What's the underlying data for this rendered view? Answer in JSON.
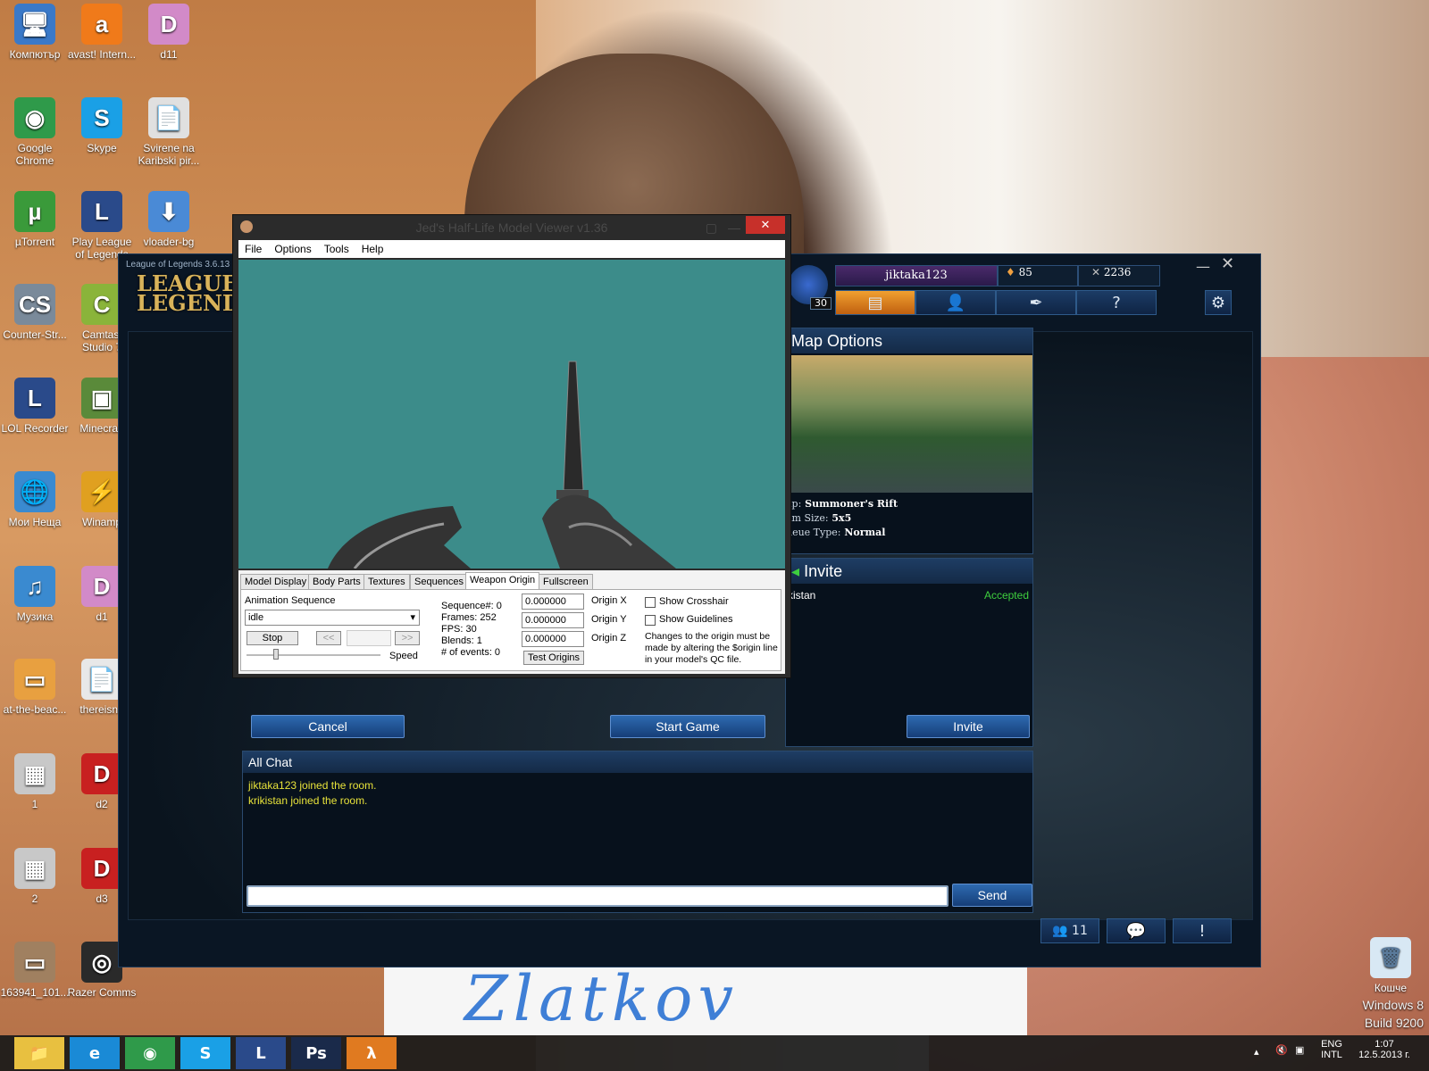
{
  "desktop": {
    "icons": [
      {
        "label": "Компютър",
        "symbol": "🖥",
        "bg": "#3a79c8"
      },
      {
        "label": "avast! Intern...",
        "symbol": "a",
        "bg": "#f07a1a"
      },
      {
        "label": "d11",
        "symbol": "D",
        "bg": "#d28ac8"
      },
      {
        "label": "Google Chrome",
        "symbol": "◉",
        "bg": "#2f9a4a"
      },
      {
        "label": "Skype",
        "symbol": "S",
        "bg": "#1aa0e6"
      },
      {
        "label": "Svirene na Karibski pir...",
        "symbol": "📄",
        "bg": "#e0e0e0"
      },
      {
        "label": "µTorrent",
        "symbol": "µ",
        "bg": "#3a9a3a"
      },
      {
        "label": "Play League of Legends",
        "symbol": "L",
        "bg": "#2a4a8a"
      },
      {
        "label": "vloader-bg",
        "symbol": "⬇",
        "bg": "#4a8ad6"
      },
      {
        "label": "Counter-Str...",
        "symbol": "CS",
        "bg": "#7a8a9a"
      },
      {
        "label": "Camtasi Studio 7",
        "symbol": "C",
        "bg": "#8ab43a"
      },
      {
        "label": "LOL Recorder",
        "symbol": "L",
        "bg": "#2a4a8a"
      },
      {
        "label": "Minecraft",
        "symbol": "▣",
        "bg": "#5a8a3a"
      },
      {
        "label": "Мои Неща",
        "symbol": "🌐",
        "bg": "#3a8ad0"
      },
      {
        "label": "Winamp",
        "symbol": "⚡",
        "bg": "#e0a020"
      },
      {
        "label": "Музика",
        "symbol": "♫",
        "bg": "#3a8ad0"
      },
      {
        "label": "d1",
        "symbol": "D",
        "bg": "#d28ac8"
      },
      {
        "label": "at-the-beac...",
        "symbol": "▭",
        "bg": "#e8a040"
      },
      {
        "label": "thereisno",
        "symbol": "📄",
        "bg": "#e8e8e8"
      },
      {
        "label": "1",
        "symbol": "▦",
        "bg": "#c8c8c8"
      },
      {
        "label": "d2",
        "symbol": "D",
        "bg": "#c82020"
      },
      {
        "label": "2",
        "symbol": "▦",
        "bg": "#c8c8c8"
      },
      {
        "label": "d3",
        "symbol": "D",
        "bg": "#c82020"
      },
      {
        "label": "163941_101...",
        "symbol": "▭",
        "bg": "#a08060"
      },
      {
        "label": "Razer Comms",
        "symbol": "◎",
        "bg": "#2a2a2a"
      }
    ],
    "recycle_bin": "Кошче",
    "watermark_line1": "Windows 8",
    "watermark_line2": "Build 9200",
    "paper_text": "Zlatkov"
  },
  "lol": {
    "window_title": "League of Legends 3.6.13",
    "logo_line1": "LEAGUE",
    "logo_line2": "LEGENDS",
    "username": "jiktaka123",
    "level": "30",
    "rp": "85",
    "ip": "2236",
    "map_options_title": "Map Options",
    "map_label": "ap:",
    "map_value": "Summoner's Rift",
    "team_label": "am Size:",
    "team_value": "5x5",
    "queue_label": "ueue Type:",
    "queue_value": "Normal",
    "invite_title": "Invite",
    "invitee": "kistan",
    "invite_status": "Accepted",
    "cancel_label": "Cancel",
    "start_label": "Start Game",
    "invite_button_label": "Invite",
    "chat_title": "All Chat",
    "chat_lines": [
      "jiktaka123 joined the room.",
      "krikistan joined the room."
    ],
    "send_label": "Send",
    "friends_count": "11",
    "status_accepted_color": "#3ecf3e"
  },
  "hlmv": {
    "title": "Jed's Half-Life Model Viewer v1.36",
    "menu": [
      "File",
      "Options",
      "Tools",
      "Help"
    ],
    "tabs": [
      "Model Display",
      "Body Parts",
      "Textures",
      "Sequences",
      "Weapon Origin",
      "Fullscreen"
    ],
    "active_tab": "Weapon Origin",
    "animation_label": "Animation Sequence",
    "animation_value": "idle",
    "stop_label": "Stop",
    "prev_label": "<<",
    "next_label": ">>",
    "speed_label": "Speed",
    "sequence": "Sequence#: 0",
    "frames": "Frames: 252",
    "fps": "FPS: 30",
    "blends": "Blends: 1",
    "events": "# of events: 0",
    "origin_x": "0.000000",
    "origin_y": "0.000000",
    "origin_z": "0.000000",
    "origin_x_label": "Origin X",
    "origin_y_label": "Origin Y",
    "origin_z_label": "Origin Z",
    "test_origins": "Test Origins",
    "show_crosshair": "Show Crosshair",
    "show_guidelines": "Show Guidelines",
    "note": "Changes to the origin must be made by altering the $origin line in your model's QC file.",
    "close_symbol": "✕",
    "viewport_color": "#3c8c8a"
  },
  "taskbar": {
    "apps": [
      {
        "name": "explorer",
        "symbol": "📁",
        "bg": "#e8c040"
      },
      {
        "name": "internet-explorer",
        "symbol": "e",
        "bg": "#1a8ad6"
      },
      {
        "name": "chrome",
        "symbol": "◉",
        "bg": "#2f9a4a"
      },
      {
        "name": "skype",
        "symbol": "S",
        "bg": "#1aa0e6"
      },
      {
        "name": "league",
        "symbol": "L",
        "bg": "#2a4a8a"
      },
      {
        "name": "photoshop",
        "symbol": "Ps",
        "bg": "#1a2a4a"
      },
      {
        "name": "half-life",
        "symbol": "λ",
        "bg": "#e07a20"
      }
    ],
    "lang_top": "ENG",
    "lang_bottom": "INTL",
    "time": "1:07",
    "date": "12.5.2013 г."
  }
}
